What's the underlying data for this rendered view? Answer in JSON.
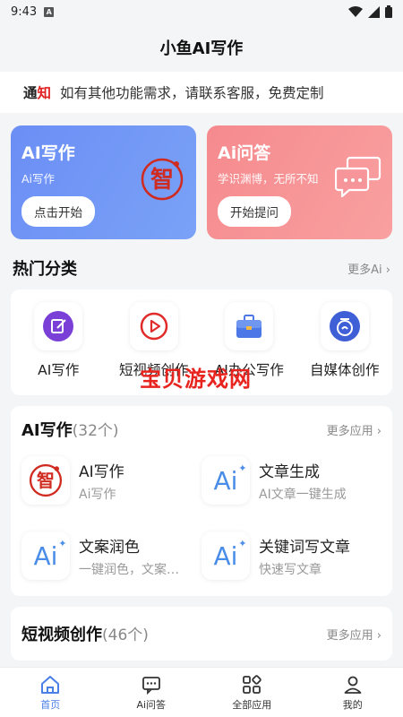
{
  "status": {
    "time": "9:43",
    "a_icon": "A"
  },
  "header": {
    "title": "小鱼AI写作"
  },
  "notice": {
    "tag_a": "通",
    "tag_b": "知",
    "text": "如有其他功能需求，请联系客服，免费定制"
  },
  "feature_cards": [
    {
      "title": "AI写作",
      "subtitle": "Ai写作",
      "button": "点击开始",
      "icon": "zhi-seal-icon",
      "badge": "智"
    },
    {
      "title": "Ai问答",
      "subtitle": "学识渊博，无所不知",
      "button": "开始提问",
      "icon": "chat-bubble-icon"
    }
  ],
  "hot": {
    "title": "热门分类",
    "more": "更多Ai",
    "items": [
      {
        "label": "AI写作",
        "icon": "edit-note-icon"
      },
      {
        "label": "短视频创作",
        "icon": "play-circle-icon"
      },
      {
        "label": "AI办公写作",
        "icon": "briefcase-icon"
      },
      {
        "label": "自媒体创作",
        "icon": "media-icon"
      }
    ]
  },
  "watermark": "宝贝游戏网",
  "ai_writing": {
    "title": "AI写作",
    "count": "(32个)",
    "more": "更多应用",
    "apps": [
      {
        "name": "AI写作",
        "desc": "Ai写作",
        "icon": "zhi-seal-icon",
        "badge": "智"
      },
      {
        "name": "文章生成",
        "desc": "AI文章一键生成",
        "icon": "ai-sparkle-icon",
        "glyph": "Ai"
      },
      {
        "name": "文案润色",
        "desc": "一键润色，文案更出彩",
        "icon": "ai-sparkle-icon",
        "glyph": "Ai"
      },
      {
        "name": "关键词写文章",
        "desc": "快速写文章",
        "icon": "ai-sparkle-icon",
        "glyph": "Ai"
      }
    ]
  },
  "short_video": {
    "title": "短视频创作",
    "count": "(46个)",
    "more": "更多应用"
  },
  "tabs": [
    {
      "label": "首页",
      "icon": "home-icon",
      "active": true
    },
    {
      "label": "Ai问答",
      "icon": "chat-icon",
      "active": false
    },
    {
      "label": "全部应用",
      "icon": "grid-icon",
      "active": false
    },
    {
      "label": "我的",
      "icon": "user-icon",
      "active": false
    }
  ],
  "colors": {
    "accent": "#4a7fe8",
    "card_blue": "#6b8ef5",
    "card_red": "#f58a8e",
    "seal_red": "#d02b20",
    "notice_red": "#e02020"
  }
}
